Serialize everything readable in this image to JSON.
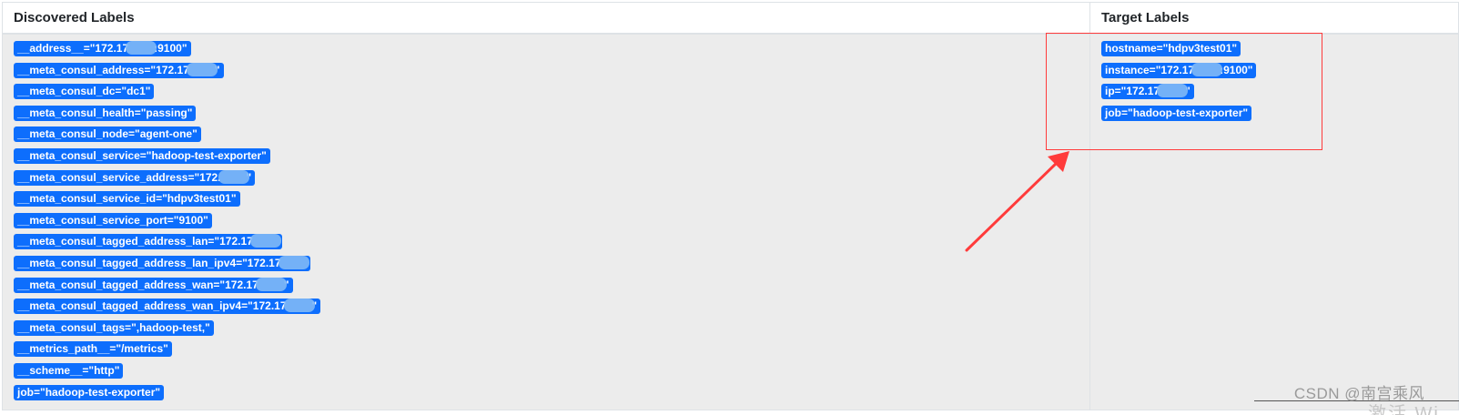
{
  "headers": {
    "discovered": "Discovered Labels",
    "target": "Target Labels"
  },
  "discovered_labels": [
    {
      "pre": "__address__=\"172.17",
      "post": ":9100\"",
      "redacted": true
    },
    {
      "pre": "__meta_consul_address=\"172.17",
      "post": "\"",
      "redacted": true
    },
    {
      "pre": "__meta_consul_dc=\"dc1\"",
      "post": "",
      "redacted": false
    },
    {
      "pre": "__meta_consul_health=\"passing\"",
      "post": "",
      "redacted": false
    },
    {
      "pre": "__meta_consul_node=\"agent-one\"",
      "post": "",
      "redacted": false
    },
    {
      "pre": "__meta_consul_service=\"hadoop-test-exporter\"",
      "post": "",
      "redacted": false
    },
    {
      "pre": "__meta_consul_service_address=\"172.",
      "post": "\"",
      "redacted": true
    },
    {
      "pre": "__meta_consul_service_id=\"hdpv3test01\"",
      "post": "",
      "redacted": false
    },
    {
      "pre": "__meta_consul_service_port=\"9100\"",
      "post": "",
      "redacted": false
    },
    {
      "pre": "__meta_consul_tagged_address_lan=\"172.17",
      "post": "",
      "redacted": true
    },
    {
      "pre": "__meta_consul_tagged_address_lan_ipv4=\"172.17",
      "post": "",
      "redacted": true
    },
    {
      "pre": "__meta_consul_tagged_address_wan=\"172.17",
      "post": "\"",
      "redacted": true
    },
    {
      "pre": "__meta_consul_tagged_address_wan_ipv4=\"172.17",
      "post": "\"",
      "redacted": true
    },
    {
      "pre": "__meta_consul_tags=\",hadoop-test,\"",
      "post": "",
      "redacted": false
    },
    {
      "pre": "__metrics_path__=\"/metrics\"",
      "post": "",
      "redacted": false
    },
    {
      "pre": "__scheme__=\"http\"",
      "post": "",
      "redacted": false
    },
    {
      "pre": "job=\"hadoop-test-exporter\"",
      "post": "",
      "redacted": false
    }
  ],
  "target_labels": [
    {
      "pre": "hostname=\"hdpv3test01\"",
      "post": "",
      "redacted": false
    },
    {
      "pre": "instance=\"172.17",
      "post": ":9100\"",
      "redacted": true
    },
    {
      "pre": "ip=\"172.17",
      "post": "\"",
      "redacted": true
    },
    {
      "pre": "job=\"hadoop-test-exporter\"",
      "post": "",
      "redacted": false
    }
  ],
  "watermark": "CSDN @南宫乘风",
  "ghost_text": "激活 Wi",
  "colors": {
    "badge": "#0d6efd",
    "annotation": "#ff3b3b",
    "cell_background": "#ececec"
  }
}
